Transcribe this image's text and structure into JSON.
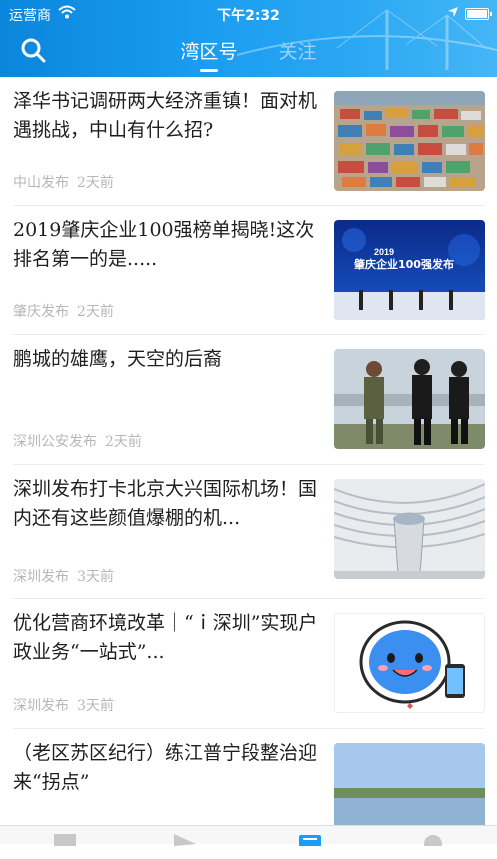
{
  "status_bar": {
    "carrier": "运营商",
    "time": "下午2:32"
  },
  "header": {
    "tabs": [
      {
        "label": "湾区号",
        "active": true
      },
      {
        "label": "关注",
        "active": false
      }
    ],
    "accent_color": "#1a9cf0"
  },
  "articles": [
    {
      "title": "泽华书记调研两大经济重镇！面对机遇挑战，中山有什么招?",
      "source": "中山发布",
      "time": "2天前",
      "image": "container-port-aerial"
    },
    {
      "title": "2019肇庆企业100强榜单揭晓!这次排名第一的是.....",
      "source": "肇庆发布",
      "time": "2天前",
      "image": "conference-stage",
      "image_text": {
        "line1": "2019",
        "line2": "肇庆企业100强发布"
      }
    },
    {
      "title": "鹏城的雄鹰，天空的后裔",
      "source": "深圳公安发布",
      "time": "2天前",
      "image": "police-pilots"
    },
    {
      "title": "深圳发布打卡北京大兴国际机场！国内还有这些颜值爆棚的机...",
      "source": "深圳发布",
      "time": "3天前",
      "image": "airport-interior"
    },
    {
      "title": "优化营商环境改革｜“ｉ深圳”实现户政业务“一站式”...",
      "source": "深圳发布",
      "time": "3天前",
      "image": "mascot"
    },
    {
      "title": "（老区苏区纪行）练江普宁段整治迎来“拐点”",
      "source": "",
      "time": "",
      "image": "river-landscape"
    }
  ],
  "tabbar": {
    "items": [
      "news-icon",
      "send-icon",
      "bay-icon",
      "profile-icon"
    ],
    "active_index": 2
  }
}
